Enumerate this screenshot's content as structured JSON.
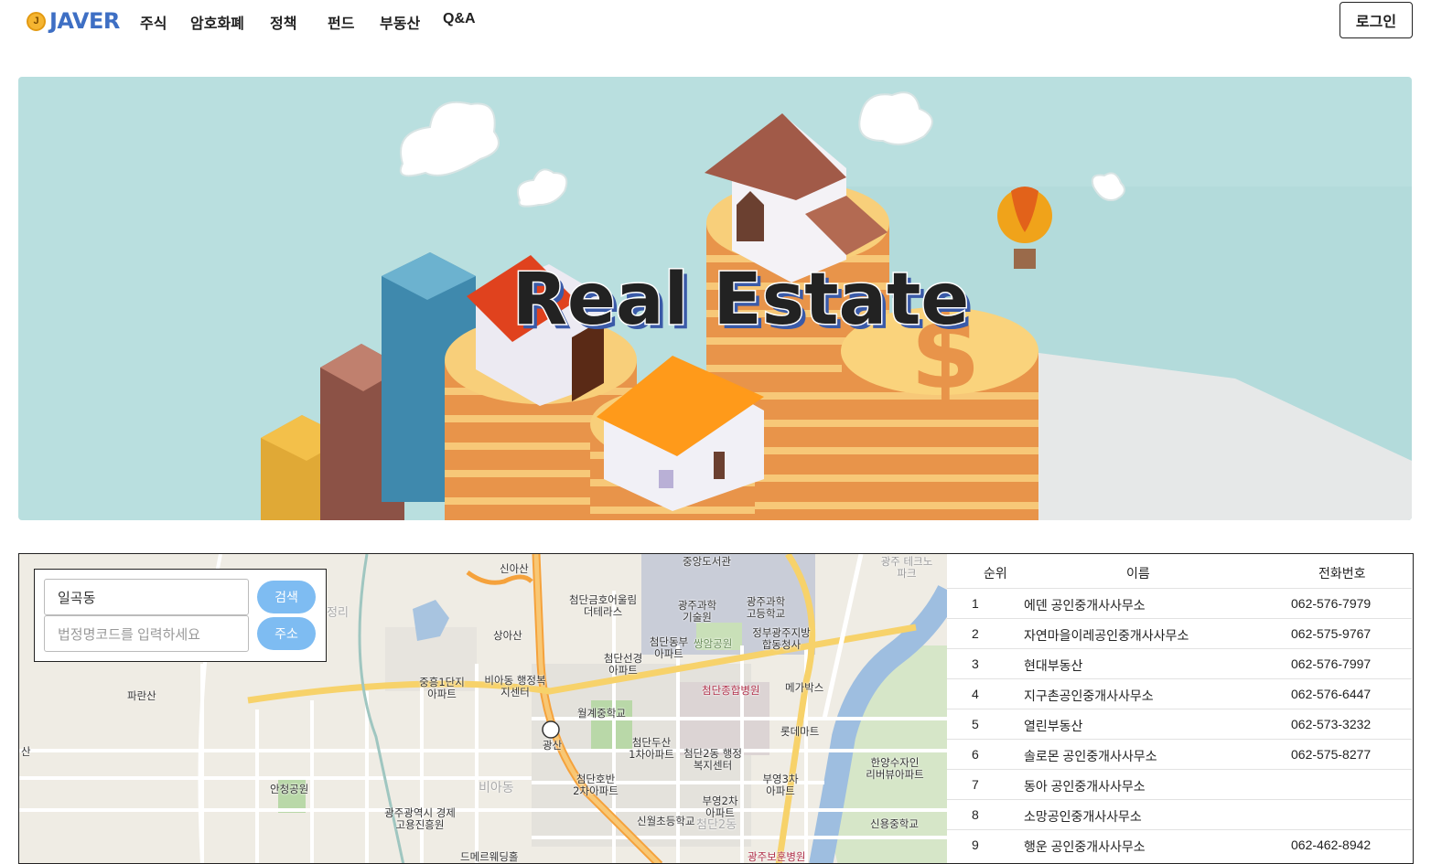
{
  "nav": {
    "logo_mark": "J",
    "logo_text": "JAVER",
    "menu": [
      "주식",
      "암호화폐",
      "정책",
      "펀드",
      "부동산",
      "Q&A"
    ],
    "login_label": "로그인"
  },
  "hero": {
    "title": "Real Estate"
  },
  "map": {
    "search_value": "일곡동",
    "search_button": "검색",
    "code_placeholder": "법정명코드를 입력하세요",
    "code_button": "주소",
    "labels": [
      "신아산",
      "중앙도서관",
      "광주 테크노파크",
      "첨단금호어울림 더테라스",
      "광주과학 기술원",
      "광주과학 고등학교",
      "상아산",
      "첨단동부 아파트",
      "쌍암공원",
      "정부광주지방 합동청사",
      "첨단선경 아파트",
      "중흥1단지 아파트",
      "비아동 행정복지센터",
      "파란산",
      "첨단종합병원",
      "메가박스",
      "월계중학교",
      "광산",
      "첨단두산 1차아파트",
      "첨단2동 행정복지센터",
      "롯데마트",
      "한양수자인 리버뷰아파트",
      "안청공원",
      "첨단호반 2차아파트",
      "비아동",
      "부영3차 아파트",
      "부영2차 아파트",
      "광주광역시 경제고용진흥원",
      "신월초등학교",
      "신용중학교",
      "드메르웨딩홀",
      "광주보훈병원",
      "첨단2동",
      "정리",
      "산"
    ]
  },
  "table": {
    "headers": {
      "rank": "순위",
      "name": "이름",
      "phone": "전화번호"
    },
    "rows": [
      {
        "rank": "1",
        "name": "에덴 공인중개사사무소",
        "phone": "062-576-7979"
      },
      {
        "rank": "2",
        "name": "자연마을이레공인중개사사무소",
        "phone": "062-575-9767"
      },
      {
        "rank": "3",
        "name": "현대부동산",
        "phone": "062-576-7997"
      },
      {
        "rank": "4",
        "name": "지구촌공인중개사사무소",
        "phone": "062-576-6447"
      },
      {
        "rank": "5",
        "name": "열린부동산",
        "phone": "062-573-3232"
      },
      {
        "rank": "6",
        "name": "솔로몬 공인중개사사무소",
        "phone": "062-575-8277"
      },
      {
        "rank": "7",
        "name": "동아 공인중개사사무소",
        "phone": ""
      },
      {
        "rank": "8",
        "name": "소망공인중개사사무소",
        "phone": ""
      },
      {
        "rank": "9",
        "name": "행운 공인중개사사무소",
        "phone": "062-462-8942"
      }
    ]
  },
  "colors": {
    "brand": "#3e6fc4",
    "button": "#7ebcf2",
    "hero_bg": "#b9dfdf"
  }
}
